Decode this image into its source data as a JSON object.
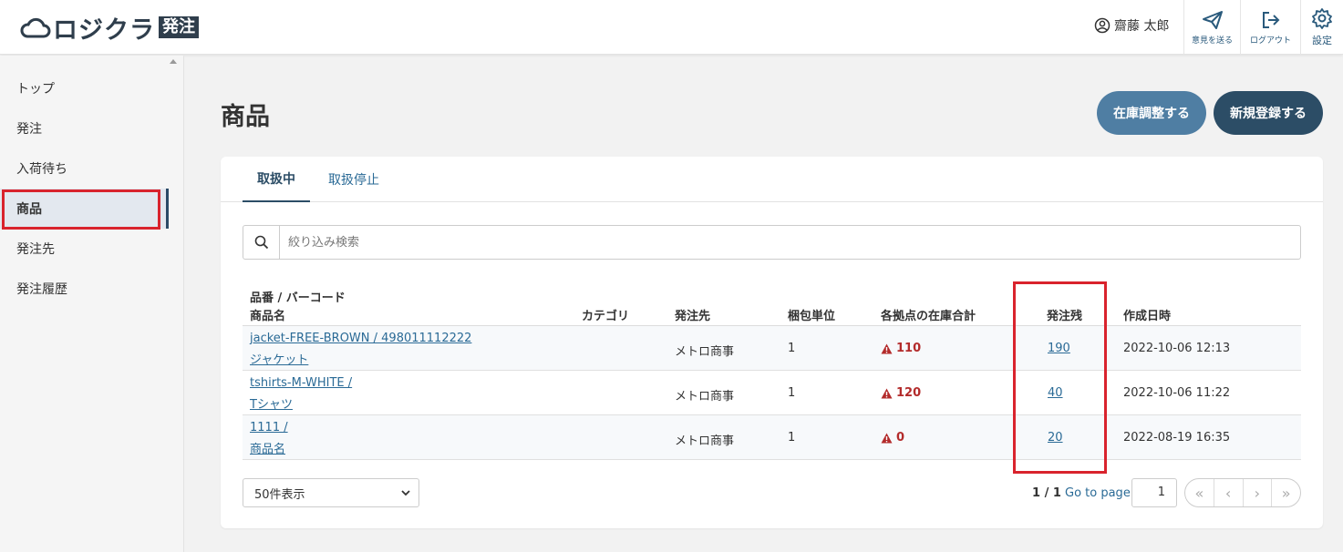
{
  "app": {
    "logo_text": "ロジクラ",
    "logo_badge": "発注"
  },
  "header": {
    "user_name": "齋藤 太郎",
    "feedback_label": "意見を送る",
    "logout_label": "ログアウト",
    "settings_label": "設定"
  },
  "sidebar": {
    "items": [
      {
        "label": "トップ"
      },
      {
        "label": "発注"
      },
      {
        "label": "入荷待ち"
      },
      {
        "label": "商品"
      },
      {
        "label": "発注先"
      },
      {
        "label": "発注履歴"
      }
    ],
    "active_index": 3
  },
  "page": {
    "title": "商品",
    "adjust_button": "在庫調整する",
    "new_button": "新規登録する"
  },
  "tabs": [
    {
      "label": "取扱中"
    },
    {
      "label": "取扱停止"
    }
  ],
  "search": {
    "placeholder": "絞り込み検索"
  },
  "table": {
    "headers": {
      "code": "品番 / バーコード",
      "name": "商品名",
      "category": "カテゴリ",
      "supplier": "発注先",
      "pack_unit": "梱包単位",
      "stock_total": "各拠点の在庫合計",
      "order_remaining": "発注残",
      "created_at": "作成日時"
    },
    "rows": [
      {
        "code": "jacket-FREE-BROWN / 498011112222",
        "name": "ジャケット",
        "category": "",
        "supplier": "メトロ商事",
        "pack_unit": "1",
        "stock_total": "110",
        "order_remaining": "190",
        "created_at": "2022-10-06 12:13"
      },
      {
        "code": "tshirts-M-WHITE /",
        "name": "Tシャツ",
        "category": "",
        "supplier": "メトロ商事",
        "pack_unit": "1",
        "stock_total": "120",
        "order_remaining": "40",
        "created_at": "2022-10-06 11:22"
      },
      {
        "code": "1111 /",
        "name": "商品名",
        "category": "",
        "supplier": "メトロ商事",
        "pack_unit": "1",
        "stock_total": "0",
        "order_remaining": "20",
        "created_at": "2022-08-19 16:35"
      }
    ]
  },
  "pagination": {
    "per_page": "50件表示",
    "page_info": "1 / 1",
    "go_to_label": "Go to page",
    "current_page": "1"
  },
  "colors": {
    "primary": "#2c4d66",
    "secondary": "#4f7ea3",
    "link": "#2a6a96",
    "warning": "#b32b2b",
    "highlight": "#d9232d"
  }
}
